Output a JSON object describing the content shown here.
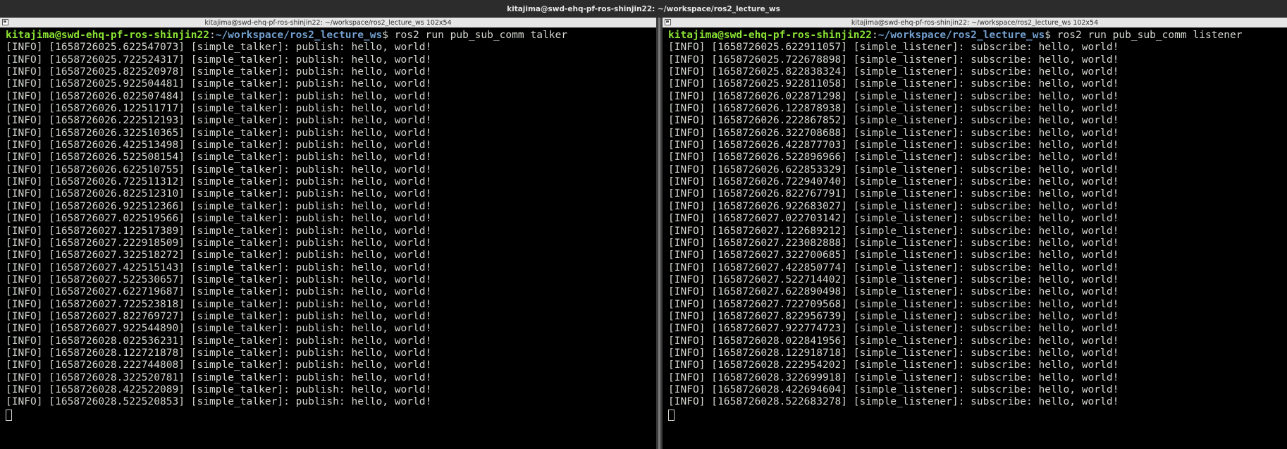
{
  "window": {
    "title": "kitajima@swd-ehq-pf-ros-shinjin22: ~/workspace/ros2_lecture_ws"
  },
  "colors": {
    "prompt_user": "#8ae234",
    "prompt_path": "#729fcf",
    "text": "#d3d7cf",
    "background": "#000000"
  },
  "left": {
    "header": "kitajima@swd-ehq-pf-ros-shinjin22: ~/workspace/ros2_lecture_ws 102x54",
    "prompt_user": "kitajima@swd-ehq-pf-ros-shinjin22",
    "prompt_sep": ":",
    "prompt_path": "~/workspace/ros2_lecture_ws",
    "prompt_cmd": "$ ros2 run pub_sub_comm talker",
    "lines": [
      "[INFO] [1658726025.622547073] [simple_talker]: publish: hello, world!",
      "[INFO] [1658726025.722524317] [simple_talker]: publish: hello, world!",
      "[INFO] [1658726025.822520978] [simple_talker]: publish: hello, world!",
      "[INFO] [1658726025.922504481] [simple_talker]: publish: hello, world!",
      "[INFO] [1658726026.022507484] [simple_talker]: publish: hello, world!",
      "[INFO] [1658726026.122511717] [simple_talker]: publish: hello, world!",
      "[INFO] [1658726026.222512193] [simple_talker]: publish: hello, world!",
      "[INFO] [1658726026.322510365] [simple_talker]: publish: hello, world!",
      "[INFO] [1658726026.422513498] [simple_talker]: publish: hello, world!",
      "[INFO] [1658726026.522508154] [simple_talker]: publish: hello, world!",
      "[INFO] [1658726026.622510755] [simple_talker]: publish: hello, world!",
      "[INFO] [1658726026.722511312] [simple_talker]: publish: hello, world!",
      "[INFO] [1658726026.822512310] [simple_talker]: publish: hello, world!",
      "[INFO] [1658726026.922512366] [simple_talker]: publish: hello, world!",
      "[INFO] [1658726027.022519566] [simple_talker]: publish: hello, world!",
      "[INFO] [1658726027.122517389] [simple_talker]: publish: hello, world!",
      "[INFO] [1658726027.222918509] [simple_talker]: publish: hello, world!",
      "[INFO] [1658726027.322518272] [simple_talker]: publish: hello, world!",
      "[INFO] [1658726027.422515143] [simple_talker]: publish: hello, world!",
      "[INFO] [1658726027.522530657] [simple_talker]: publish: hello, world!",
      "[INFO] [1658726027.622719687] [simple_talker]: publish: hello, world!",
      "[INFO] [1658726027.722523818] [simple_talker]: publish: hello, world!",
      "[INFO] [1658726027.822769727] [simple_talker]: publish: hello, world!",
      "[INFO] [1658726027.922544890] [simple_talker]: publish: hello, world!",
      "[INFO] [1658726028.022536231] [simple_talker]: publish: hello, world!",
      "[INFO] [1658726028.122721878] [simple_talker]: publish: hello, world!",
      "[INFO] [1658726028.222744808] [simple_talker]: publish: hello, world!",
      "[INFO] [1658726028.322520781] [simple_talker]: publish: hello, world!",
      "[INFO] [1658726028.422522089] [simple_talker]: publish: hello, world!",
      "[INFO] [1658726028.522520853] [simple_talker]: publish: hello, world!"
    ]
  },
  "right": {
    "header": "kitajima@swd-ehq-pf-ros-shinjin22: ~/workspace/ros2_lecture_ws 102x54",
    "prompt_user": "kitajima@swd-ehq-pf-ros-shinjin22",
    "prompt_sep": ":",
    "prompt_path": "~/workspace/ros2_lecture_ws",
    "prompt_cmd": "$ ros2 run pub_sub_comm listener",
    "lines": [
      "[INFO] [1658726025.622911057] [simple_listener]: subscribe: hello, world!",
      "[INFO] [1658726025.722678898] [simple_listener]: subscribe: hello, world!",
      "[INFO] [1658726025.822838324] [simple_listener]: subscribe: hello, world!",
      "[INFO] [1658726025.922811058] [simple_listener]: subscribe: hello, world!",
      "[INFO] [1658726026.022871298] [simple_listener]: subscribe: hello, world!",
      "[INFO] [1658726026.122878938] [simple_listener]: subscribe: hello, world!",
      "[INFO] [1658726026.222867852] [simple_listener]: subscribe: hello, world!",
      "[INFO] [1658726026.322708688] [simple_listener]: subscribe: hello, world!",
      "[INFO] [1658726026.422877703] [simple_listener]: subscribe: hello, world!",
      "[INFO] [1658726026.522896966] [simple_listener]: subscribe: hello, world!",
      "[INFO] [1658726026.622853329] [simple_listener]: subscribe: hello, world!",
      "[INFO] [1658726026.722940740] [simple_listener]: subscribe: hello, world!",
      "[INFO] [1658726026.822767791] [simple_listener]: subscribe: hello, world!",
      "[INFO] [1658726026.922683027] [simple_listener]: subscribe: hello, world!",
      "[INFO] [1658726027.022703142] [simple_listener]: subscribe: hello, world!",
      "[INFO] [1658726027.122689212] [simple_listener]: subscribe: hello, world!",
      "[INFO] [1658726027.223082888] [simple_listener]: subscribe: hello, world!",
      "[INFO] [1658726027.322700685] [simple_listener]: subscribe: hello, world!",
      "[INFO] [1658726027.422850774] [simple_listener]: subscribe: hello, world!",
      "[INFO] [1658726027.522714402] [simple_listener]: subscribe: hello, world!",
      "[INFO] [1658726027.622890498] [simple_listener]: subscribe: hello, world!",
      "[INFO] [1658726027.722709568] [simple_listener]: subscribe: hello, world!",
      "[INFO] [1658726027.822956739] [simple_listener]: subscribe: hello, world!",
      "[INFO] [1658726027.922774723] [simple_listener]: subscribe: hello, world!",
      "[INFO] [1658726028.022841956] [simple_listener]: subscribe: hello, world!",
      "[INFO] [1658726028.122918718] [simple_listener]: subscribe: hello, world!",
      "[INFO] [1658726028.222954202] [simple_listener]: subscribe: hello, world!",
      "[INFO] [1658726028.322699918] [simple_listener]: subscribe: hello, world!",
      "[INFO] [1658726028.422694604] [simple_listener]: subscribe: hello, world!",
      "[INFO] [1658726028.522683278] [simple_listener]: subscribe: hello, world!"
    ]
  }
}
